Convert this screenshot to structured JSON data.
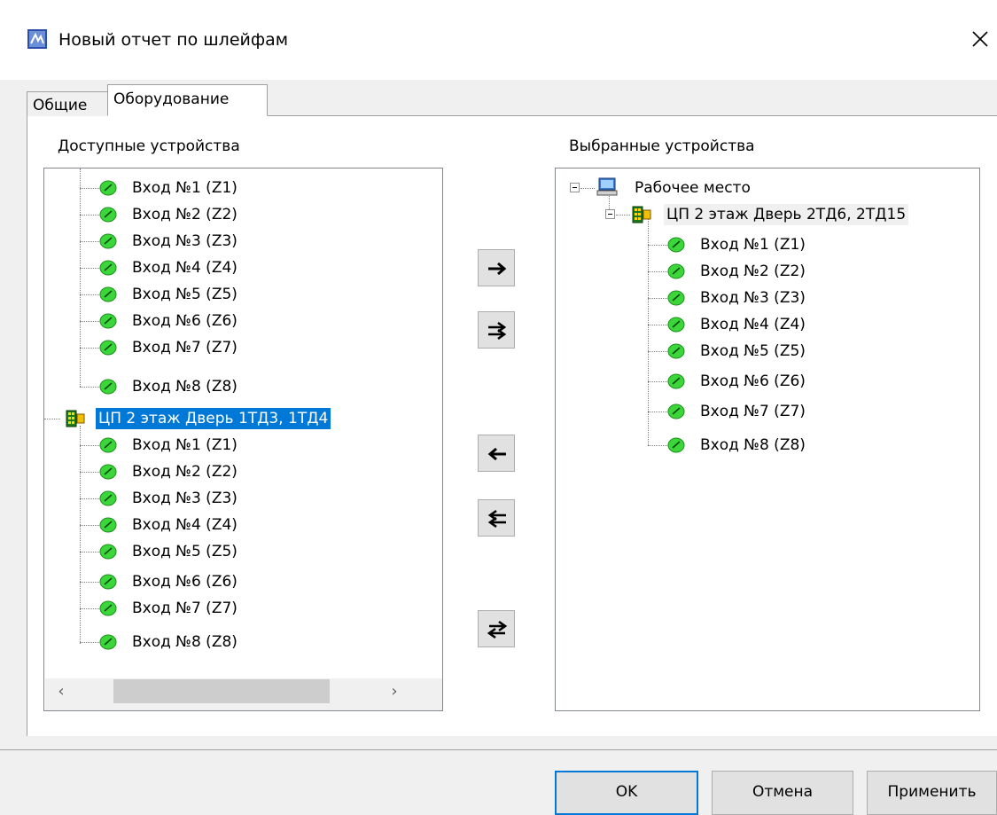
{
  "window": {
    "title": "Новый отчет по шлейфам"
  },
  "tabs": [
    {
      "label": "Общие",
      "active": false
    },
    {
      "label": "Оборудование",
      "active": true
    }
  ],
  "available": {
    "label": "Доступные устройства",
    "group1_zones": [
      "Вход №1 (Z1)",
      "Вход №2 (Z2)",
      "Вход №3 (Z3)",
      "Вход №4 (Z4)",
      "Вход №5 (Z5)",
      "Вход №6 (Z6)",
      "Вход №7 (Z7)",
      "Вход №8 (Z8)"
    ],
    "device2": {
      "label": "ЦП 2 этаж Дверь 1ТД3, 1ТД4",
      "selected": true
    },
    "group2_zones": [
      "Вход №1 (Z1)",
      "Вход №2 (Z2)",
      "Вход №3 (Z3)",
      "Вход №4 (Z4)",
      "Вход №5 (Z5)",
      "Вход №6 (Z6)",
      "Вход №7 (Z7)",
      "Вход №8 (Z8)"
    ]
  },
  "selected": {
    "label": "Выбранные устройства",
    "workstation": "Рабочее место",
    "device": "ЦП 2 этаж Дверь 2ТД6, 2ТД15",
    "zones": [
      "Вход №1 (Z1)",
      "Вход №2 (Z2)",
      "Вход №3 (Z3)",
      "Вход №4 (Z4)",
      "Вход №5 (Z5)",
      "Вход №6 (Z6)",
      "Вход №7 (Z7)",
      "Вход №8 (Z8)"
    ]
  },
  "move_buttons": [
    {
      "icon": "arrow-right-icon"
    },
    {
      "icon": "double-arrow-right-icon"
    },
    {
      "icon": "arrow-left-icon"
    },
    {
      "icon": "double-arrow-left-icon"
    },
    {
      "icon": "swap-arrows-icon"
    }
  ],
  "buttons": {
    "ok": "OK",
    "cancel": "Отмена",
    "apply": "Применить"
  },
  "colors": {
    "selection": "#0078d7",
    "zone_icon": "#3ad63a",
    "panel_bg": "#f0f0f0"
  }
}
